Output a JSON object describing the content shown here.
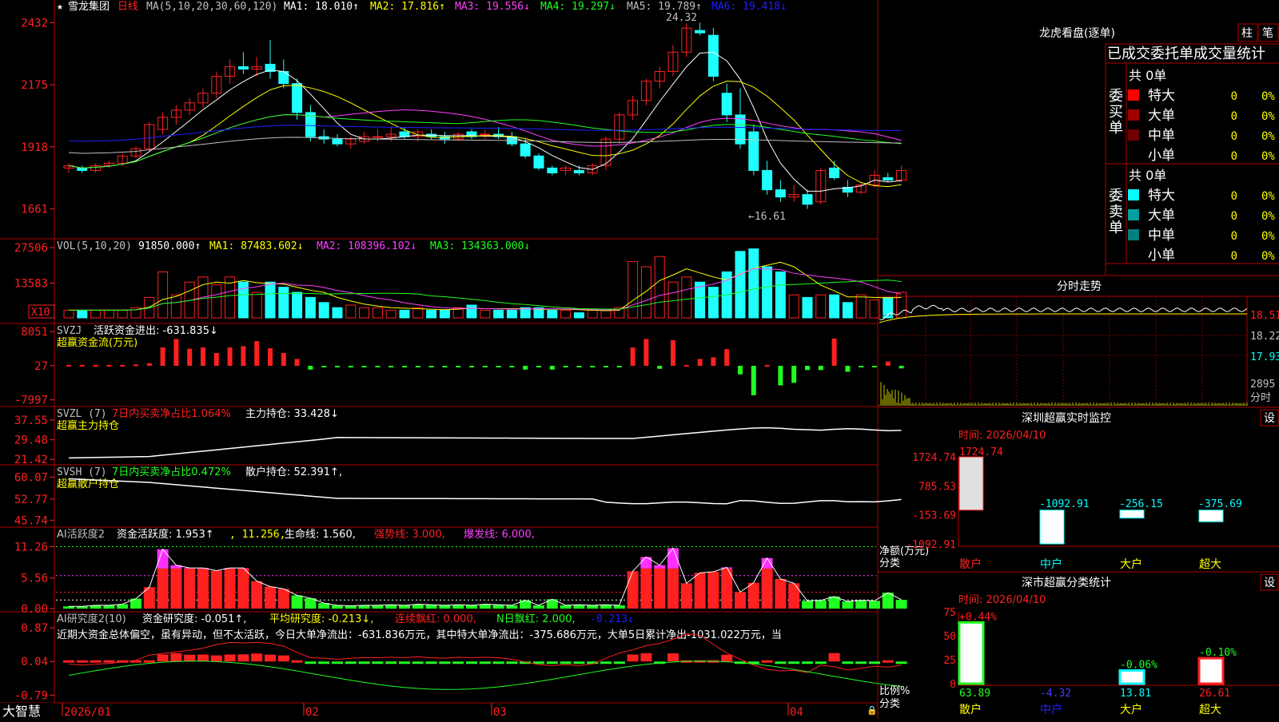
{
  "stock": {
    "star": "★",
    "name": "雪龙集团",
    "period": "日线"
  },
  "brand": "大智慧",
  "dates": [
    "2026/01",
    "02",
    "03",
    "04"
  ],
  "colors": {
    "up": "#ff2020",
    "down": "#20ffff",
    "frame": "#b00000"
  },
  "main_legend": {
    "ma_label": "MA(5,10,20,30,60,120)",
    "ma1": "MA1: 18.010↑",
    "ma2": "MA2: 17.816↑",
    "ma3": "MA3: 19.556↓",
    "ma4": "MA4: 19.297↓",
    "ma5": "MA5: 19.789↑",
    "ma6": "MA6: 19.418↓"
  },
  "main_annotations": {
    "high": "24.32",
    "low": "16.61"
  },
  "vol_legend": {
    "label": "VOL(5,10,20)",
    "value": "91850.000↑",
    "ma1": "MA1: 87483.602↓",
    "ma2": "MA2: 108396.102↓",
    "ma3": "MA3: 134363.000↓",
    "unit": "X10"
  },
  "svzj_legend": {
    "label": "SVZJ",
    "value": "活跃资金进出: -631.835↓",
    "sub": "超赢资金流(万元)"
  },
  "svzl_legend": {
    "label": "SVZL (7)",
    "ratio": "7日内买卖净占比1.064%",
    "value": "主力持仓: 33.428↓",
    "sub": "超赢主力持仓"
  },
  "svsh_legend": {
    "label": "SVSH (7)",
    "ratio": "7日内买卖净占比0.472%",
    "value": "散户持仓: 52.391↑,",
    "sub": "超赢散户持仓"
  },
  "ai_legend": {
    "label": "AI活跃度2",
    "value": "资金活跃度: 1.953↑",
    "v2": ", 11.256,",
    "life": "生命线: 1.560,",
    "strong": "强势线: 3.000,",
    "burst": "爆发线: 6.000,"
  },
  "ai2_legend": {
    "label": "AI研究度2(10)",
    "value": "资金研究度: -0.051↑,",
    "avg": "平均研究度: -0.213↓,",
    "red": "连续飘红: 0.000,",
    "nred": "N日飘红: 2.000,",
    "extra": "-0.213↓",
    "note": "近期大资金总体偏空，虽有异动，但不太活跃，今日大单净流出：-631.836万元，其中特大单净流出：-375.686万元，大单5日累计净出-1031.022万元，当"
  },
  "right": {
    "lhkp_title": "龙虎看盘(逐单)",
    "btn_zhu": "柱",
    "btn_bi": "笔",
    "lhkp_header": "已成交委托单成交量统计",
    "buy_side": {
      "label": "委买单",
      "total": "共 0单",
      "rows": [
        {
          "name": "特大",
          "count": "0",
          "pct": "0%",
          "color": "#ff0000"
        },
        {
          "name": "大单",
          "count": "0",
          "pct": "0%",
          "color": "#a00000"
        },
        {
          "name": "中单",
          "count": "0",
          "pct": "0%",
          "color": "#700000"
        },
        {
          "name": "小单",
          "count": "0",
          "pct": "0%",
          "color": ""
        }
      ]
    },
    "sell_side": {
      "label": "委卖单",
      "total": "共 0单",
      "rows": [
        {
          "name": "特大",
          "count": "0",
          "pct": "0%",
          "color": "#00ffff"
        },
        {
          "name": "大单",
          "count": "0",
          "pct": "0%",
          "color": "#00a0a0"
        },
        {
          "name": "中单",
          "count": "0",
          "pct": "0%",
          "color": "#008080"
        },
        {
          "name": "小单",
          "count": "0",
          "pct": "0%",
          "color": ""
        }
      ]
    },
    "intraday_title": "分时走势",
    "intraday_ticks": [
      "18.51",
      "18.22",
      "17.93",
      "2895",
      "分时"
    ],
    "sz_title": "深圳超赢实时监控",
    "sz_time": "时间: 2026/04/10",
    "sz_btn": "设",
    "sz_unit": "净额(万元)",
    "sz_cat_label": "分类",
    "ss_title": "深市超赢分类统计",
    "ss_time": "时间: 2026/04/10",
    "ss_btn": "设",
    "ss_unit": "比例%",
    "ss_cat_label": "分类",
    "ss_bottom": [
      "63.89",
      "-4.32",
      "13.81",
      "26.61"
    ]
  },
  "chart_data": [
    {
      "type": "candlestick",
      "name_on_chart": "",
      "yticks": [
        2432,
        2175,
        1918,
        1661
      ],
      "ytick_labels": [
        "2432",
        "2175",
        "1918",
        "1661"
      ],
      "ylim": [
        15.6,
        24.6
      ],
      "ohlc": [
        [
          18.3,
          18.5,
          18.1,
          18.4
        ],
        [
          18.3,
          18.4,
          18.1,
          18.2
        ],
        [
          18.2,
          18.5,
          18.1,
          18.4
        ],
        [
          18.4,
          18.6,
          18.3,
          18.5
        ],
        [
          18.5,
          18.9,
          18.4,
          18.8
        ],
        [
          18.8,
          19.2,
          18.7,
          19.1
        ],
        [
          19.1,
          20.2,
          19.0,
          20.1
        ],
        [
          19.9,
          20.6,
          19.7,
          20.4
        ],
        [
          20.4,
          20.9,
          20.1,
          20.7
        ],
        [
          20.7,
          21.2,
          20.5,
          21.0
        ],
        [
          21.0,
          21.6,
          20.8,
          21.4
        ],
        [
          21.4,
          22.3,
          21.2,
          22.1
        ],
        [
          22.1,
          22.8,
          21.8,
          22.5
        ],
        [
          22.5,
          23.1,
          22.2,
          22.4
        ],
        [
          22.4,
          22.9,
          22.1,
          22.5
        ],
        [
          22.6,
          23.6,
          22.0,
          22.3
        ],
        [
          22.3,
          22.8,
          21.6,
          21.8
        ],
        [
          21.8,
          22.0,
          20.3,
          20.6
        ],
        [
          20.6,
          20.9,
          19.4,
          19.6
        ],
        [
          19.6,
          19.9,
          19.3,
          19.5
        ],
        [
          19.5,
          19.7,
          19.2,
          19.3
        ],
        [
          19.3,
          19.6,
          19.1,
          19.5
        ],
        [
          19.4,
          19.8,
          19.3,
          19.6
        ],
        [
          19.6,
          19.9,
          19.4,
          19.6
        ],
        [
          19.6,
          20.0,
          19.4,
          19.7
        ],
        [
          19.8,
          20.0,
          19.5,
          19.6
        ],
        [
          19.6,
          19.9,
          19.4,
          19.8
        ],
        [
          19.7,
          19.9,
          19.5,
          19.6
        ],
        [
          19.6,
          19.8,
          19.3,
          19.5
        ],
        [
          19.5,
          19.8,
          19.4,
          19.7
        ],
        [
          19.8,
          19.9,
          19.5,
          19.6
        ],
        [
          19.7,
          19.9,
          19.5,
          19.7
        ],
        [
          19.7,
          20.0,
          19.5,
          19.6
        ],
        [
          19.6,
          19.8,
          19.2,
          19.3
        ],
        [
          19.3,
          19.5,
          18.7,
          18.8
        ],
        [
          18.8,
          18.9,
          18.2,
          18.3
        ],
        [
          18.3,
          18.4,
          18.0,
          18.1
        ],
        [
          18.2,
          18.4,
          18.0,
          18.3
        ],
        [
          18.2,
          18.4,
          18.0,
          18.1
        ],
        [
          18.1,
          18.5,
          18.0,
          18.4
        ],
        [
          18.4,
          19.6,
          18.2,
          19.5
        ],
        [
          19.5,
          20.6,
          19.3,
          20.5
        ],
        [
          20.5,
          21.3,
          20.3,
          21.1
        ],
        [
          21.1,
          22.0,
          20.9,
          21.9
        ],
        [
          21.9,
          22.5,
          21.6,
          22.3
        ],
        [
          22.3,
          23.4,
          22.1,
          23.1
        ],
        [
          23.1,
          24.3,
          22.9,
          24.1
        ],
        [
          24.0,
          24.32,
          23.8,
          23.9
        ],
        [
          23.8,
          24.1,
          21.9,
          22.1
        ],
        [
          21.4,
          21.8,
          20.2,
          20.5
        ],
        [
          20.5,
          21.6,
          19.1,
          19.3
        ],
        [
          19.8,
          20.1,
          18.0,
          18.2
        ],
        [
          18.2,
          18.6,
          17.2,
          17.4
        ],
        [
          17.4,
          17.8,
          16.9,
          17.1
        ],
        [
          17.1,
          17.6,
          16.9,
          17.2
        ],
        [
          17.2,
          17.4,
          16.61,
          16.8
        ],
        [
          16.9,
          18.3,
          16.8,
          18.2
        ],
        [
          18.3,
          18.6,
          17.8,
          17.9
        ],
        [
          17.5,
          17.8,
          17.1,
          17.3
        ],
        [
          17.3,
          17.7,
          17.2,
          17.6
        ],
        [
          17.6,
          18.2,
          17.5,
          18.0
        ],
        [
          17.9,
          18.1,
          17.7,
          17.8
        ],
        [
          17.8,
          18.4,
          17.7,
          18.2
        ]
      ],
      "ma_series": [
        {
          "key": "ma5",
          "color": "#ffffff"
        },
        {
          "key": "ma10",
          "color": "#ffff00"
        },
        {
          "key": "ma20",
          "color": "#ff40ff"
        },
        {
          "key": "ma30",
          "color": "#20ff20"
        },
        {
          "key": "ma60",
          "color": "#2020ff"
        },
        {
          "key": "ma120",
          "color": "#c0c0c0"
        }
      ]
    },
    {
      "type": "bar",
      "name_on_chart": "VOL",
      "yticks": [
        27506,
        13583
      ],
      "ytick_labels": [
        "27506",
        "13583"
      ],
      "ylim": [
        0,
        30000
      ],
      "values": [
        3,
        3,
        3,
        3,
        3,
        4,
        8,
        18,
        9,
        14,
        16,
        13,
        16,
        14,
        10,
        14,
        12,
        10,
        8,
        6,
        4,
        5,
        4,
        4,
        3,
        3,
        4,
        3,
        3,
        4,
        5,
        3,
        3,
        3,
        4,
        4,
        3,
        3,
        2,
        3,
        3,
        4,
        22,
        20,
        24,
        14,
        16,
        14,
        12,
        18,
        26,
        27,
        20,
        18,
        9,
        8,
        9,
        9,
        6,
        9,
        7,
        8,
        10
      ]
    },
    {
      "type": "bar",
      "name_on_chart": "SVZJ",
      "yticks": [
        8051,
        27,
        -7997
      ],
      "ytick_labels": [
        "8051",
        "27",
        "-7997"
      ],
      "ylim": [
        -9000,
        9000
      ],
      "values": [
        200,
        200,
        200,
        200,
        200,
        300,
        600,
        4300,
        6300,
        4000,
        4300,
        3000,
        4300,
        4600,
        5800,
        4100,
        3000,
        1600,
        -900,
        -200,
        -200,
        -200,
        -200,
        -200,
        -300,
        -200,
        -300,
        -200,
        -200,
        -300,
        -200,
        -300,
        -200,
        -300,
        -900,
        -200,
        -900,
        -200,
        -300,
        -200,
        -300,
        -200,
        4300,
        6300,
        -700,
        6000,
        200,
        1600,
        2000,
        3900,
        -2000,
        -6900,
        200,
        -4600,
        -4000,
        -1000,
        -1000,
        6400,
        -1400,
        -300,
        -200,
        1000,
        -600
      ]
    },
    {
      "type": "line",
      "name_on_chart": "SVZL",
      "yticks": [
        37.55,
        29.48,
        21.42
      ],
      "ytick_labels": [
        "37.55",
        "29.48",
        "21.42"
      ],
      "ylim": [
        20.5,
        39.5
      ]
    },
    {
      "type": "line",
      "name_on_chart": "SVSH",
      "yticks": [
        60.07,
        52.77,
        45.74
      ],
      "ytick_labels": [
        "60.07",
        "52.77",
        "45.74"
      ],
      "ylim": [
        44.5,
        61.5
      ]
    },
    {
      "type": "bar",
      "name_on_chart": "AI活跃度2",
      "yticks": [
        11.26,
        5.56,
        0.0
      ],
      "ytick_labels": [
        "11.26",
        "5.56",
        "0.00"
      ],
      "ylim": [
        0,
        12.5
      ],
      "values": [
        0.4,
        0.4,
        0.6,
        0.6,
        0.8,
        1.8,
        3.9,
        10.8,
        7.9,
        7.4,
        7.4,
        6.9,
        7.4,
        7.4,
        5.0,
        4.0,
        3.6,
        2.4,
        1.9,
        1.0,
        0.6,
        0.5,
        0.6,
        0.6,
        0.7,
        0.6,
        0.8,
        0.7,
        0.6,
        0.7,
        0.6,
        0.8,
        0.7,
        0.6,
        1.5,
        0.6,
        1.7,
        0.6,
        0.7,
        0.6,
        0.7,
        0.6,
        6.8,
        9.4,
        7.9,
        11.0,
        4.6,
        6.5,
        6.7,
        7.5,
        3.0,
        4.7,
        9.2,
        5.4,
        4.6,
        1.4,
        1.5,
        2.2,
        1.3,
        1.5,
        1.4,
        2.9,
        1.6
      ],
      "pink_threshold": 7.3
    },
    {
      "type": "bar",
      "name_on_chart": "AI研究度2",
      "yticks": [
        0.87,
        0.04,
        -0.79
      ],
      "ytick_labels": [
        "0.87",
        "0.04",
        "-0.79"
      ],
      "ylim": [
        -0.9,
        0.95
      ]
    },
    {
      "type": "bar",
      "name_on_chart": "深圳超赢实时监控",
      "yticks": [
        1724.74,
        785.53,
        -153.69,
        -1092.91
      ],
      "ytick_labels": [
        "1724.74",
        "785.53",
        "-153.69",
        "-1092.91"
      ],
      "categories": [
        "散户",
        "中户",
        "大户",
        "超大"
      ],
      "values": [
        1724.74,
        -1092.91,
        -256.15,
        -375.69
      ],
      "value_labels": [
        "1724.74",
        "-1092.91",
        "-256.15",
        "-375.69"
      ],
      "ylim": [
        -1092.91,
        1724.74
      ]
    },
    {
      "type": "bar",
      "name_on_chart": "深市超赢分类统计",
      "yticks": [
        75,
        50,
        25,
        0
      ],
      "ytick_labels": [
        "75",
        "50",
        "25",
        "0"
      ],
      "categories": [
        "散户",
        "中户",
        "大户",
        "超大"
      ],
      "values": [
        63.89,
        -4.32,
        13.81,
        26.61
      ],
      "value_labels": [
        "+0.44%",
        "",
        "-0.06%",
        "-0.10%"
      ],
      "ylim": [
        0,
        75
      ]
    }
  ]
}
